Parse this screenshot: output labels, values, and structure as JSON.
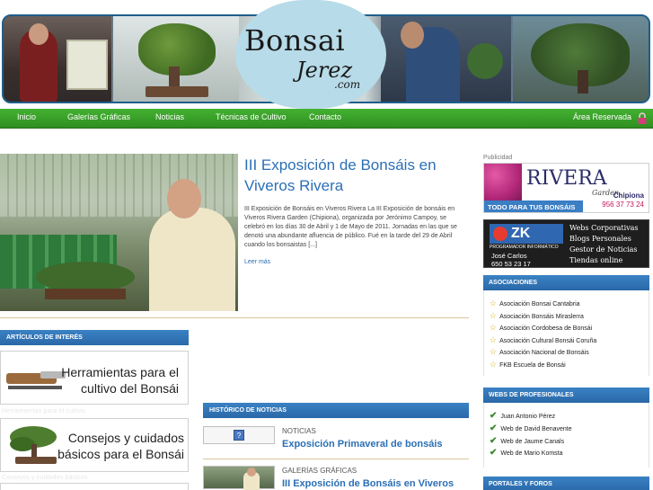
{
  "header": {
    "logo_line1": "Bonsai",
    "logo_line2": "Jerez",
    "logo_line3": ".com"
  },
  "nav": {
    "items": [
      "Inicio",
      "Galerías Gráficas",
      "Noticias",
      "Técnicas de Cultivo",
      "Contacto"
    ],
    "area_reservada": "Área Reservada"
  },
  "featured": {
    "title": "III Exposición de Bonsáis en Viveros Rivera",
    "text": "III Exposición de Bonsáis en Viveros Rivera La III Exposición de bonsáis en Viveros Rivera Garden (Chipiona), organizada por Jerónimo Campoy, se celebró en los días 30 de Abril y 1 de Mayo de 2011. Jornadas en las que se denotó una abundante afluencia de público. Fué en la tarde del 29 de Abril cuando los bonsaistas [...]",
    "read_more": "Leer más"
  },
  "articles": {
    "header": "ARTÍCULOS DE INTERÉS",
    "items": [
      {
        "title_line1": "Herramientas para el",
        "title_line2": "cultivo del Bonsái",
        "subtitle": "Herramientas para el cultivo"
      },
      {
        "title_line1": "Consejos y cuidados",
        "title_line2": "básicos para el Bonsái",
        "subtitle": "Consejos y cuidados básicos"
      }
    ]
  },
  "historico": {
    "header": "HISTÓRICO DE NOTICIAS",
    "items": [
      {
        "category": "NOTICIAS",
        "title": "Exposición Primaveral de bonsáis"
      },
      {
        "category": "GALERÍAS GRÁFICAS",
        "title": "III Exposición de Bonsáis en Viveros"
      }
    ]
  },
  "sidebar": {
    "publicidad": "Publicidad",
    "ad_rivera": {
      "brand": "RIVERA",
      "sub": "Garden",
      "tagline": "TODO PARA TUS BONSÁIS",
      "city": "Chipiona",
      "phone": "956 37 73 24"
    },
    "ad_zk": {
      "logo": "ZK",
      "role": "PROGRAMADOR INFORMÁTICO",
      "name": "José Carlos",
      "phone": "650 53 23 17",
      "services": [
        "Webs Corporativas",
        "Blogs Personales",
        "Gestor de Noticias",
        "Tiendas online"
      ]
    },
    "asociaciones": {
      "header": "ASOCIACIONES",
      "items": [
        "Asociación Bonsai Cantabria",
        "Asociación Bonsáis Miraslerra",
        "Asociación Cordobesa de Bonsái",
        "Asociación Cultural Bonsái Coruña",
        "Asociación Nacional de Bonsáis",
        "FKB Escuela de Bonsái"
      ]
    },
    "profesionales": {
      "header": "WEBS DE PROFESIONALES",
      "items": [
        "Juan Antonio Pérez",
        "Web de David Benavente",
        "Web de Jaume Canals",
        "Web de Mario Komsta"
      ]
    },
    "portales": {
      "header": "PORTALES Y FOROS"
    }
  }
}
